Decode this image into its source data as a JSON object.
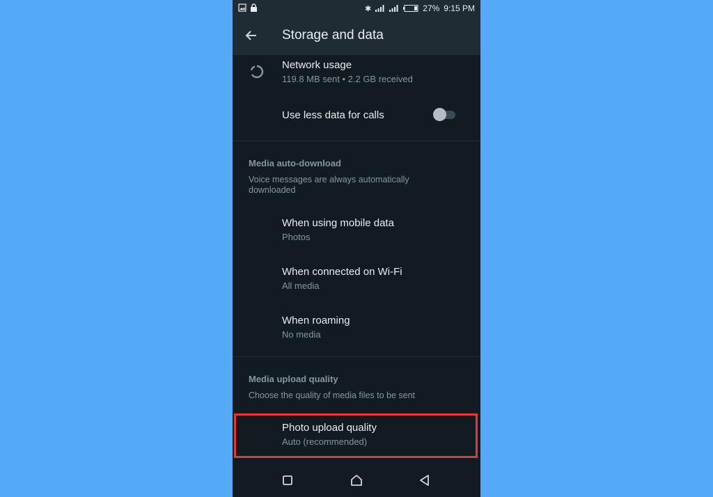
{
  "status_bar": {
    "left_icons": [
      "image-icon",
      "lock-icon"
    ],
    "right_icons": [
      "bluetooth-icon",
      "signal-icon",
      "signal-icon",
      "battery-icon"
    ],
    "battery": "27%",
    "time": "9:15 PM"
  },
  "app_bar": {
    "back_icon": "arrow-left-icon",
    "title": "Storage and data"
  },
  "settings": {
    "network_usage": {
      "icon": "data-usage-icon",
      "title": "Network usage",
      "subtitle": "119.8 MB sent • 2.2 GB received"
    },
    "less_data_calls": {
      "title": "Use less data for calls",
      "toggle_on": false
    },
    "auto_download": {
      "header": "Media auto-download",
      "description": "Voice messages are always automatically downloaded",
      "items": [
        {
          "title": "When using mobile data",
          "subtitle": "Photos"
        },
        {
          "title": "When connected on Wi-Fi",
          "subtitle": "All media"
        },
        {
          "title": "When roaming",
          "subtitle": "No media"
        }
      ]
    },
    "upload_quality": {
      "header": "Media upload quality",
      "description": "Choose the quality of media files to be sent",
      "photo": {
        "title": "Photo upload quality",
        "subtitle": "Auto (recommended)"
      }
    }
  },
  "nav_bar": {
    "buttons": [
      "recents-icon",
      "home-icon",
      "back-icon"
    ]
  },
  "colors": {
    "background": "#55aaf8",
    "surface": "#121b22",
    "highlight": "#e53935"
  }
}
